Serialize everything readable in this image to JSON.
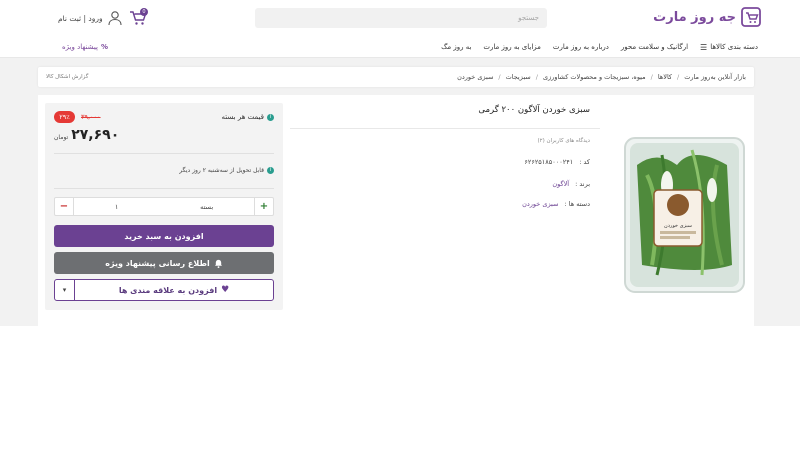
{
  "header": {
    "logo_text": "جه روز مارت",
    "search_placeholder": "جستجو",
    "login_text": "ورود | ثبت نام",
    "cart_count": "0",
    "accent": "#6b4192"
  },
  "nav": {
    "items": [
      "دسته بندی کالاها",
      "ارگانیک و سلامت محور",
      "درباره به روز مارت",
      "مزایای به روز مارت",
      "به روز مگ"
    ],
    "offers": "پیشنهاد ویژه"
  },
  "breadcrumb": {
    "items": [
      "بازار آنلاین به‌روز مارت",
      "کالاها",
      "میوه، سبزیجات و محصولات کشاورزی",
      "سبزیجات",
      "سبزی خوردن"
    ],
    "report": "گزارش اشکال کالا"
  },
  "buy_box": {
    "price_label": "قیمت هر بسته",
    "discount": "۲۹٪",
    "old_price": "۳۹,۰۰۰",
    "new_price": "۲۷,۶۹۰",
    "currency": "تومان",
    "delivery": "قابل تحویل از سه‌شنبه ۲ روز دیگر",
    "qty_value": "۱",
    "qty_unit": "بسته",
    "add_to_cart": "افزودن به سبد خرید",
    "notify": "اطلاع رسانی پیشنهاد ویژه",
    "wishlist": "افزودن به علاقه مندی ها"
  },
  "product": {
    "title": "سبزی خوردن آلاگون ۲۰۰ گرمی",
    "reviews": "دیدگاه های کاربران (۲)",
    "code_label": "کد :",
    "code_value": "۶۲۶۲۵۱۸۵۰۰۰۲۴۱",
    "brand_label": "برند :",
    "brand_value": "آلاگون",
    "category_label": "دسته ها :",
    "category_value": "سبزی خوردن",
    "package_label": "سبزی خوردن"
  }
}
